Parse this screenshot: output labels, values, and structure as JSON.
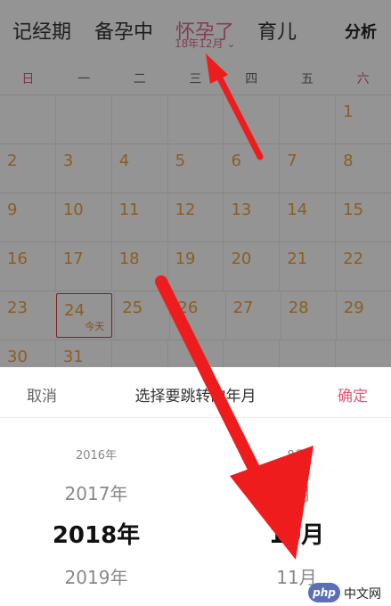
{
  "tabs": {
    "record": "记经期",
    "prepare": "备孕中",
    "pregnant": "怀孕了",
    "pregnant_sub": "18年12月",
    "child": "育儿",
    "analysis": "分析"
  },
  "weekdays": [
    "日",
    "一",
    "二",
    "三",
    "四",
    "五",
    "六"
  ],
  "calendar": {
    "weeks": [
      [
        "",
        "",
        "",
        "",
        "",
        "",
        "1"
      ],
      [
        "2",
        "3",
        "4",
        "5",
        "6",
        "7",
        "8"
      ],
      [
        "9",
        "10",
        "11",
        "12",
        "13",
        "14",
        "15"
      ],
      [
        "16",
        "17",
        "18",
        "19",
        "20",
        "21",
        "22"
      ],
      [
        "23",
        "24",
        "25",
        "26",
        "27",
        "28",
        "29"
      ],
      [
        "30",
        "31",
        "",
        "",
        "",
        "",
        ""
      ]
    ],
    "today_label": "今天"
  },
  "picker": {
    "cancel": "取消",
    "title": "选择要跳转的年月",
    "confirm": "确定",
    "years": [
      "2016年",
      "2017年",
      "2018年",
      "2019年"
    ],
    "months": [
      "8月",
      "9月",
      "10月",
      "11月"
    ]
  },
  "watermark": {
    "mark": "php",
    "text": "中文网"
  },
  "colors": {
    "accent": "#e06a92",
    "date_number": "#f0a23a",
    "today_border": "#d93535",
    "arrow": "#ee1c1c"
  },
  "icons": {
    "month_dropdown": "chevron-down-icon"
  }
}
